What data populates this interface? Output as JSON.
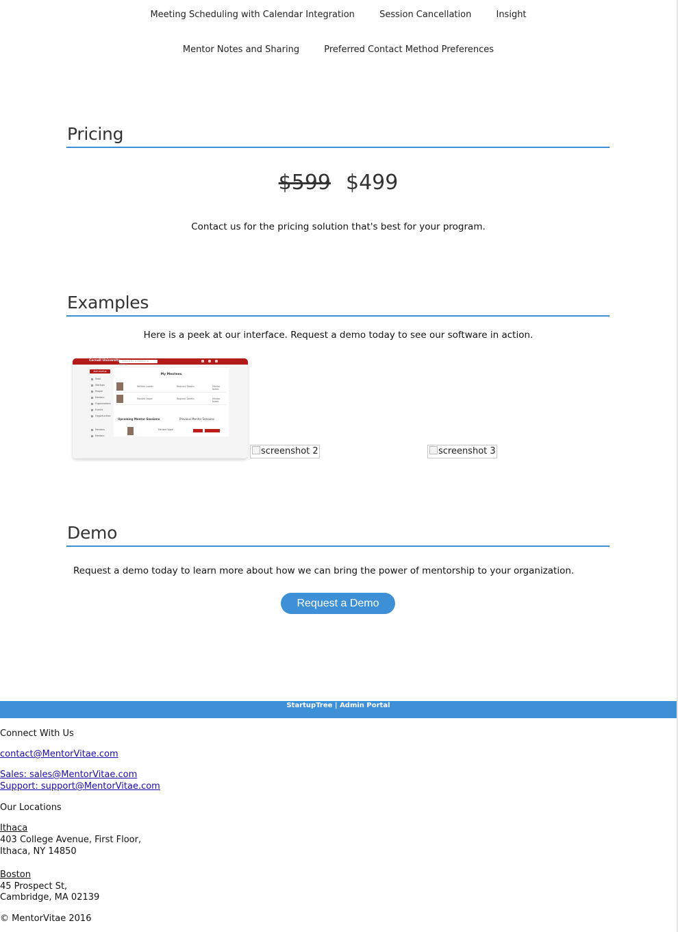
{
  "feature_nav": {
    "row1": [
      "Meeting Scheduling with Calendar Integration",
      "Session Cancellation",
      "Insight"
    ],
    "row2": [
      "Mentor Notes and Sharing",
      "Preferred Contact Method Preferences"
    ]
  },
  "pricing": {
    "title": "Pricing",
    "old_price": "$599",
    "new_price": "$499",
    "note": "Contact us for the pricing solution that's best for your program."
  },
  "examples": {
    "title": "Examples",
    "intro": "Here is a peek at our interface. Request a demo today to see our software in action.",
    "screenshot_1": {
      "brand": "Cornell University",
      "search_placeholder": "Search for a mentor or startup",
      "sidebar_button": "Add startup",
      "sidebar_items": [
        "Feed",
        "Startups",
        "People",
        "Mentors",
        "Organizations",
        "Events",
        "Opportunities",
        "Mentees",
        "Mentors"
      ],
      "heading": "My Mentees",
      "mentees": [
        {
          "name": "William Lawler",
          "action": "Request Details",
          "button": "Mentor Notes"
        },
        {
          "name": "Mentee Vogel",
          "action": "Request Details",
          "button": "Mentor Notes"
        }
      ],
      "tabs": [
        "Upcoming Mentor Sessions",
        "Previous Mentor Sessions"
      ],
      "session_text": "Mentee Vogel"
    },
    "screenshot_2_alt": "screenshot 2",
    "screenshot_3_alt": "screenshot 3"
  },
  "demo": {
    "title": "Demo",
    "text": "Request a demo today to learn more about how we can bring the power of mentorship to your organization.",
    "button_label": "Request a Demo"
  },
  "footer": {
    "bar": {
      "startuptree": "StartupTree",
      "separator": "|",
      "admin_portal": "Admin Portal"
    },
    "connect_heading": "Connect With Us",
    "contact_email": "contact@MentorVitae.com",
    "sales": "Sales: sales@MentorVitae.com",
    "support": "Support: support@MentorVitae.com",
    "locations_heading": "Our Locations",
    "locations": [
      {
        "name": "Ithaca",
        "line1": "403 College Avenue, First Floor,",
        "line2": "Ithaca, NY 14850"
      },
      {
        "name": "Boston",
        "line1": "45 Prospect St,",
        "line2": "Cambridge, MA 02139"
      }
    ],
    "copyright": "© MentorVitae 2016"
  },
  "colors": {
    "accent": "#3d8fd6",
    "brand_red": "#b31b1b"
  }
}
